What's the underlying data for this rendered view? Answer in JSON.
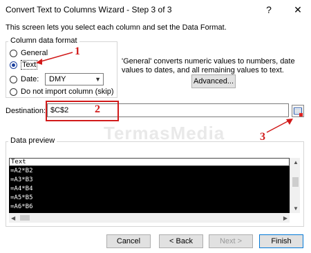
{
  "window": {
    "title": "Convert Text to Columns Wizard - Step 3 of 3",
    "help_glyph": "?",
    "close_glyph": "✕"
  },
  "description": "This screen lets you select each column and set the Data Format.",
  "column_format": {
    "legend": "Column data format",
    "options": [
      {
        "label": "General",
        "checked": false
      },
      {
        "label": "Text",
        "checked": true
      },
      {
        "label": "Date:",
        "checked": false
      },
      {
        "label": "Do not import column (skip)",
        "checked": false
      }
    ],
    "date_select_value": "DMY"
  },
  "info_text": "'General' converts numeric values to numbers, date values to dates, and all remaining values to text.",
  "advanced_label": "Advanced...",
  "destination": {
    "label": "Destination:",
    "value": "$C$2"
  },
  "annotations": [
    "1",
    "2",
    "3"
  ],
  "watermark": "TermasMedia",
  "data_preview": {
    "legend": "Data preview",
    "header": "Text",
    "rows": [
      "=A2*B2",
      "=A3*B3",
      "=A4*B4",
      "=A5*B5",
      "=A6*B6"
    ]
  },
  "buttons": {
    "cancel": "Cancel",
    "back": "< Back",
    "next": "Next >",
    "finish": "Finish"
  },
  "colors": {
    "annotation_red": "#d11a1a",
    "preview_bg": "#000000",
    "accent": "#0078d7"
  }
}
